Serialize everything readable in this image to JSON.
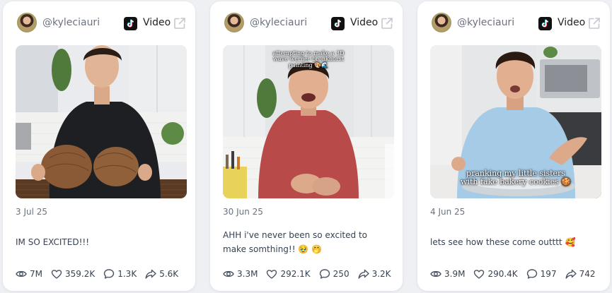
{
  "cards": [
    {
      "handle": "@kyleciauri",
      "platform": "Video",
      "platform_icon": "tiktok-icon",
      "overlay_text": "",
      "date": "3 Jul 25",
      "caption": "IM SO EXCITED!!!",
      "views": "7M",
      "likes": "359.2K",
      "comments": "1.3K",
      "shares": "5.6K"
    },
    {
      "handle": "@kyleciauri",
      "platform": "Video",
      "platform_icon": "tiktok-icon",
      "overlay_text": "attempting to make a 3D wave werner bronkhorst painting 🎨🌊",
      "date": "30 Jun 25",
      "caption": "AHH i've never been so excited to make somthing!! 🥹 🤭",
      "views": "3.3M",
      "likes": "292.1K",
      "comments": "250",
      "shares": "3.2K"
    },
    {
      "handle": "@kyleciauri",
      "platform": "Video",
      "platform_icon": "tiktok-icon",
      "overlay_text": "pranking my little sisters with fake bakery cookies 🍪",
      "date": "4 Jun 25",
      "caption": "lets see how these come outttt 🥰",
      "views": "3.9M",
      "likes": "290.4K",
      "comments": "197",
      "shares": "742"
    }
  ],
  "icons": {
    "views": "eye-icon",
    "likes": "heart-icon",
    "comments": "comment-icon",
    "shares": "share-icon",
    "external": "external-link-icon"
  },
  "colors": {
    "page_bg": "#eef0f4",
    "card_bg": "#ffffff",
    "muted_text": "#6b7280",
    "body_text": "#374151",
    "tiktok_bg": "#111111"
  }
}
